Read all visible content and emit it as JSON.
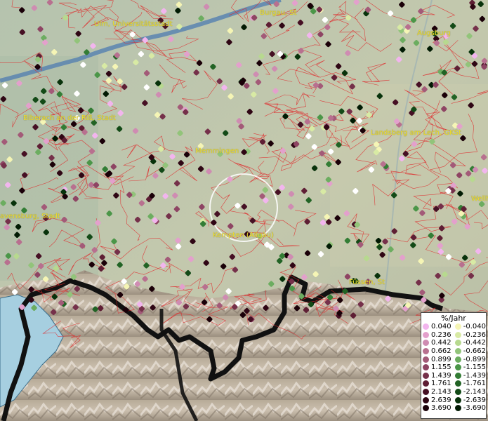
{
  "map": {
    "places": [
      {
        "name": "Ulm, Universitätsstadt"
      },
      {
        "name": "Burgau, St"
      },
      {
        "name": "Augsburg"
      },
      {
        "name": "Biberach an der Riß, Stadt"
      },
      {
        "name": "Memmingen"
      },
      {
        "name": "Landsberg am Lech, GKSt"
      },
      {
        "name": "Wellh"
      },
      {
        "name": "avensburg, Stadt"
      },
      {
        "name": "Kempten (Allgäu)"
      },
      {
        "name": "Füssen, St"
      }
    ]
  },
  "legend": {
    "title": "%/Jahr",
    "positive": [
      {
        "value": "0.040",
        "color": "#f2b5ee"
      },
      {
        "value": "0.236",
        "color": "#e3a0cc"
      },
      {
        "value": "0.442",
        "color": "#cf8cb2"
      },
      {
        "value": "0.662",
        "color": "#b8708f"
      },
      {
        "value": "0.899",
        "color": "#a35a78"
      },
      {
        "value": "1.155",
        "color": "#8e4463"
      },
      {
        "value": "1.439",
        "color": "#75304a"
      },
      {
        "value": "1.761",
        "color": "#5e1e34"
      },
      {
        "value": "2.143",
        "color": "#461024"
      },
      {
        "value": "2.639",
        "color": "#2f0614"
      },
      {
        "value": "3.690",
        "color": "#1a0008"
      }
    ],
    "negative": [
      {
        "value": "-0.040",
        "color": "#f5f5b5"
      },
      {
        "value": "-0.236",
        "color": "#d8eaa4"
      },
      {
        "value": "-0.442",
        "color": "#b7d98f"
      },
      {
        "value": "-0.662",
        "color": "#92c47a"
      },
      {
        "value": "-0.899",
        "color": "#6cad60"
      },
      {
        "value": "-1.155",
        "color": "#4b9648"
      },
      {
        "value": "-1.439",
        "color": "#337d35"
      },
      {
        "value": "-1.761",
        "color": "#226325"
      },
      {
        "value": "-2.143",
        "color": "#134a17"
      },
      {
        "value": "-2.639",
        "color": "#08320b"
      },
      {
        "value": "-3.690",
        "color": "#011a03"
      }
    ]
  }
}
